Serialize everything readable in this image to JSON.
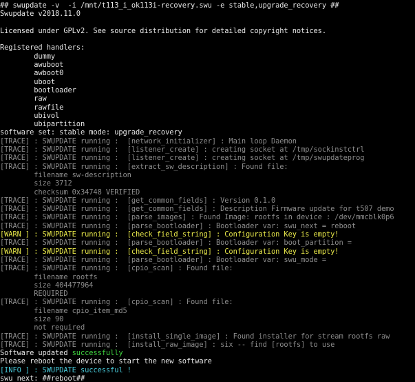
{
  "colors": {
    "background": "#000000",
    "text": "#e6e6e6",
    "trace": "#8c8c8c",
    "warn": "#e8e84a",
    "success": "#3fd43f",
    "info": "#48c8d8"
  },
  "lines": [
    {
      "segments": [
        {
          "c": "w",
          "t": "## swupdate -v  -i /mnt/t113_i_ok113i-recovery.swu -e stable,upgrade_recovery ##"
        }
      ]
    },
    {
      "segments": [
        {
          "c": "w",
          "t": "Swupdate v2018.11.0"
        }
      ]
    },
    {
      "segments": []
    },
    {
      "segments": [
        {
          "c": "w",
          "t": "Licensed under GPLv2. See source distribution for detailed copyright notices."
        }
      ]
    },
    {
      "segments": []
    },
    {
      "segments": [
        {
          "c": "w",
          "t": "Registered handlers:"
        }
      ]
    },
    {
      "segments": [
        {
          "c": "w",
          "t": "        dummy"
        }
      ]
    },
    {
      "segments": [
        {
          "c": "w",
          "t": "        awuboot"
        }
      ]
    },
    {
      "segments": [
        {
          "c": "w",
          "t": "        awboot0"
        }
      ]
    },
    {
      "segments": [
        {
          "c": "w",
          "t": "        uboot"
        }
      ]
    },
    {
      "segments": [
        {
          "c": "w",
          "t": "        bootloader"
        }
      ]
    },
    {
      "segments": [
        {
          "c": "w",
          "t": "        raw"
        }
      ]
    },
    {
      "segments": [
        {
          "c": "w",
          "t": "        rawfile"
        }
      ]
    },
    {
      "segments": [
        {
          "c": "w",
          "t": "        ubivol"
        }
      ]
    },
    {
      "segments": [
        {
          "c": "w",
          "t": "        ubipartition"
        }
      ]
    },
    {
      "segments": [
        {
          "c": "w",
          "t": "software set: stable mode: upgrade_recovery"
        }
      ]
    },
    {
      "segments": [
        {
          "c": "g",
          "t": "[TRACE] : SWUPDATE running :  [network_initializer] : Main loop Daemon"
        }
      ]
    },
    {
      "segments": [
        {
          "c": "g",
          "t": "[TRACE] : SWUPDATE running :  [listener_create] : creating socket at /tmp/sockinstctrl"
        }
      ]
    },
    {
      "segments": [
        {
          "c": "g",
          "t": "[TRACE] : SWUPDATE running :  [listener_create] : creating socket at /tmp/swupdateprog"
        }
      ]
    },
    {
      "segments": [
        {
          "c": "g",
          "t": "[TRACE] : SWUPDATE running :  [extract_sw_description] : Found file:"
        }
      ]
    },
    {
      "segments": [
        {
          "c": "g",
          "t": "        filename sw-description"
        }
      ]
    },
    {
      "segments": [
        {
          "c": "g",
          "t": "        size 3712"
        }
      ]
    },
    {
      "segments": [
        {
          "c": "g",
          "t": "        checksum 0x34748 VERIFIED"
        }
      ]
    },
    {
      "segments": [
        {
          "c": "g",
          "t": "[TRACE] : SWUPDATE running :  [get_common_fields] : Version 0.1.0"
        }
      ]
    },
    {
      "segments": [
        {
          "c": "g",
          "t": "[TRACE] : SWUPDATE running :  [get_common_fields] : Description Firmware update for t507 demo"
        }
      ]
    },
    {
      "segments": [
        {
          "c": "g",
          "t": "[TRACE] : SWUPDATE running :  [parse_images] : Found Image: rootfs in device : /dev/mmcblk0p6"
        }
      ]
    },
    {
      "segments": [
        {
          "c": "g",
          "t": "[TRACE] : SWUPDATE running :  [parse_bootloader] : Bootloader var: swu_next = reboot"
        }
      ]
    },
    {
      "segments": [
        {
          "c": "y",
          "t": "[WARN ] : SWUPDATE running :  [check_field_string] : Configuration Key is empty!"
        }
      ]
    },
    {
      "segments": [
        {
          "c": "g",
          "t": "[TRACE] : SWUPDATE running :  [parse_bootloader] : Bootloader var: boot_partition ="
        }
      ]
    },
    {
      "segments": [
        {
          "c": "y",
          "t": "[WARN ] : SWUPDATE running :  [check_field_string] : Configuration Key is empty!"
        }
      ]
    },
    {
      "segments": [
        {
          "c": "g",
          "t": "[TRACE] : SWUPDATE running :  [parse_bootloader] : Bootloader var: swu_mode ="
        }
      ]
    },
    {
      "segments": [
        {
          "c": "g",
          "t": "[TRACE] : SWUPDATE running :  [cpio_scan] : Found file:"
        }
      ]
    },
    {
      "segments": [
        {
          "c": "g",
          "t": "        filename rootfs"
        }
      ]
    },
    {
      "segments": [
        {
          "c": "g",
          "t": "        size 404477964"
        }
      ]
    },
    {
      "segments": [
        {
          "c": "g",
          "t": "        REQUIRED"
        }
      ]
    },
    {
      "segments": [
        {
          "c": "g",
          "t": "[TRACE] : SWUPDATE running :  [cpio_scan] : Found file:"
        }
      ]
    },
    {
      "segments": [
        {
          "c": "g",
          "t": "        filename cpio_item_md5"
        }
      ]
    },
    {
      "segments": [
        {
          "c": "g",
          "t": "        size 90"
        }
      ]
    },
    {
      "segments": [
        {
          "c": "g",
          "t": "        not required"
        }
      ]
    },
    {
      "segments": [
        {
          "c": "g",
          "t": "[TRACE] : SWUPDATE running :  [install_single_image] : Found installer for stream rootfs raw"
        }
      ]
    },
    {
      "segments": [
        {
          "c": "g",
          "t": "[TRACE] : SWUPDATE running :  [install_raw_image] : six -- find [rootfs] to use"
        }
      ]
    },
    {
      "segments": [
        {
          "c": "w",
          "t": "Software updated "
        },
        {
          "c": "gr",
          "t": "successfully"
        }
      ]
    },
    {
      "segments": [
        {
          "c": "w",
          "t": "Please reboot the device to start the new software"
        }
      ]
    },
    {
      "segments": [
        {
          "c": "c",
          "t": "[INFO ] : SWUPDATE successful !"
        }
      ]
    },
    {
      "segments": [
        {
          "c": "w",
          "t": "swu_next: ##reboot##"
        }
      ]
    }
  ]
}
